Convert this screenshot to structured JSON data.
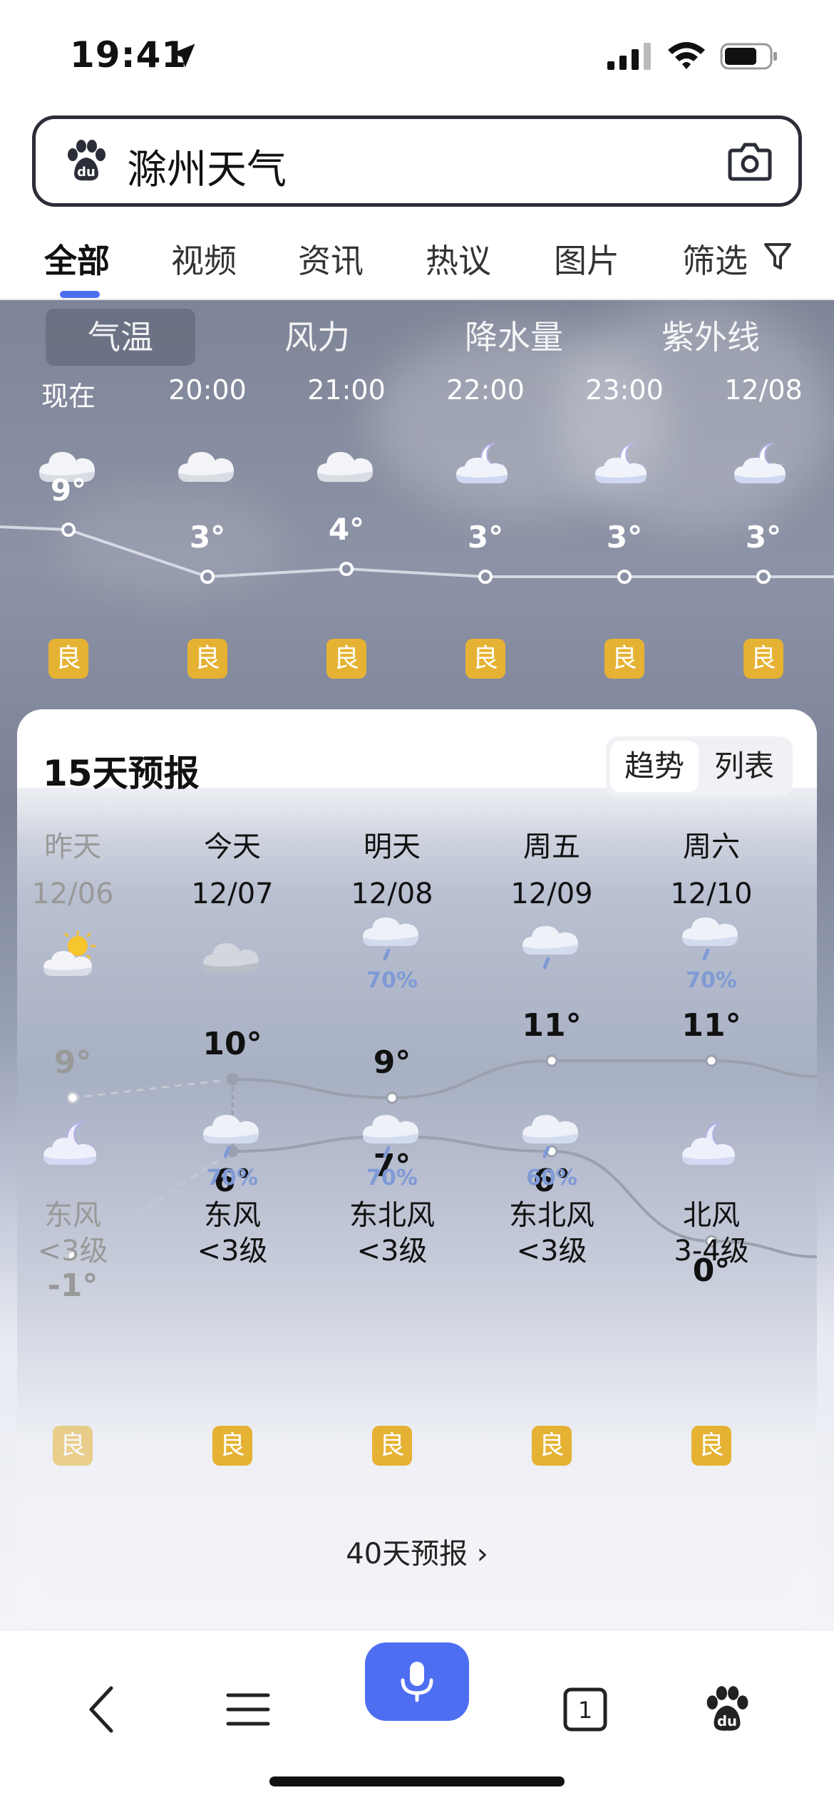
{
  "status_bar": {
    "time": "19:41"
  },
  "search": {
    "query": "滁州天气"
  },
  "tabs": [
    {
      "label": "全部",
      "active": true
    },
    {
      "label": "视频"
    },
    {
      "label": "资讯"
    },
    {
      "label": "热议"
    },
    {
      "label": "图片"
    },
    {
      "label": "筛选"
    }
  ],
  "hourly": {
    "metrics": [
      "气温",
      "风力",
      "降水量",
      "紫外线"
    ],
    "active_metric": "气温",
    "hours": [
      {
        "time": "现在",
        "icon": "cloud-icon",
        "temp": "9°",
        "aqi": "良"
      },
      {
        "time": "20:00",
        "icon": "cloud-icon",
        "temp": "3°",
        "aqi": "良"
      },
      {
        "time": "21:00",
        "icon": "cloud-icon",
        "temp": "4°",
        "aqi": "良"
      },
      {
        "time": "22:00",
        "icon": "moon-cloud-icon",
        "temp": "3°",
        "aqi": "良"
      },
      {
        "time": "23:00",
        "icon": "moon-cloud-icon",
        "temp": "3°",
        "aqi": "良"
      },
      {
        "time": "12/08",
        "icon": "moon-cloud-icon",
        "temp": "3°",
        "aqi": "良"
      }
    ],
    "temps_num": [
      9,
      3,
      4,
      3,
      3,
      3
    ]
  },
  "forecast": {
    "title": "15天预报",
    "toggle": [
      "趋势",
      "列表"
    ],
    "days": [
      {
        "name": "昨天",
        "date": "12/06",
        "day_icon": "sun-cloud-icon",
        "day_precip": "",
        "high": "9°",
        "low": "-1°",
        "night_icon": "moon-cloud-icon",
        "night_precip": "",
        "wind_dir": "东风",
        "wind_level": "<3级",
        "aqi": "良",
        "past": true
      },
      {
        "name": "今天",
        "date": "12/07",
        "day_icon": "cloud-icon",
        "day_precip": "",
        "high": "10°",
        "low": "6°",
        "night_icon": "rain-cloud-icon",
        "night_precip": "70%",
        "wind_dir": "东风",
        "wind_level": "<3级",
        "aqi": "良"
      },
      {
        "name": "明天",
        "date": "12/08",
        "day_icon": "rain-cloud-icon",
        "day_precip": "70%",
        "high": "9°",
        "low": "7°",
        "night_icon": "rain-cloud-icon",
        "night_precip": "70%",
        "wind_dir": "东北风",
        "wind_level": "<3级",
        "aqi": "良"
      },
      {
        "name": "周五",
        "date": "12/09",
        "day_icon": "rain-cloud-icon",
        "day_precip": "",
        "high": "11°",
        "low": "6°",
        "night_icon": "rain-cloud-icon",
        "night_precip": "60%",
        "wind_dir": "东北风",
        "wind_level": "<3级",
        "aqi": "良"
      },
      {
        "name": "周六",
        "date": "12/10",
        "day_icon": "rain-cloud-icon",
        "day_precip": "70%",
        "high": "11°",
        "low": "0°",
        "night_icon": "moon-cloud-icon",
        "night_precip": "",
        "wind_dir": "北风",
        "wind_level": "3-4级",
        "aqi": "良"
      }
    ],
    "highs_num": [
      9,
      10,
      9,
      11,
      11
    ],
    "lows_num": [
      -1,
      6,
      7,
      6,
      0
    ],
    "more_button": "40天预报 ›"
  },
  "colors": {
    "accent": "#4e6ef2",
    "aqi_good": "#e6b233",
    "precip": "#7f9ad6"
  }
}
